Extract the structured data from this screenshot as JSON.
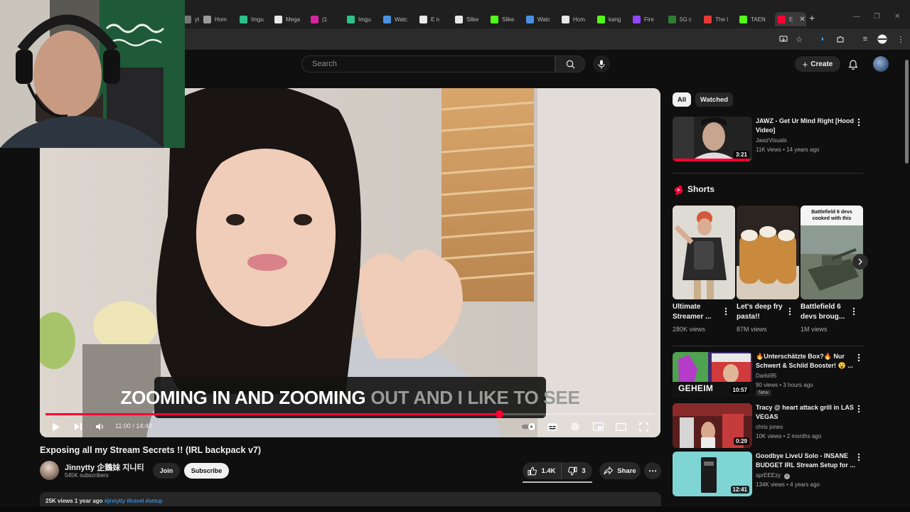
{
  "browser": {
    "tabs": [
      {
        "label": "yt",
        "color": "#777777"
      },
      {
        "label": "Hom",
        "color": "#9a9a9a"
      },
      {
        "label": "Imgu",
        "color": "#2ec28a"
      },
      {
        "label": "Mega",
        "color": "#e8e8e8"
      },
      {
        "label": "(1",
        "color": "#d6249f"
      },
      {
        "label": "Imgu",
        "color": "#2ec28a"
      },
      {
        "label": "Watc",
        "color": "#4a90e2"
      },
      {
        "label": "E n",
        "color": "#e8e8e8"
      },
      {
        "label": "Slike",
        "color": "#e8e8e8"
      },
      {
        "label": "Slike",
        "color": "#53fc18"
      },
      {
        "label": "Watc",
        "color": "#4a90e2"
      },
      {
        "label": "Hom",
        "color": "#e8e8e8"
      },
      {
        "label": "kang",
        "color": "#53fc18"
      },
      {
        "label": "Fire",
        "color": "#9146ff"
      },
      {
        "label": "5G c",
        "color": "#2e7d32"
      },
      {
        "label": "The I",
        "color": "#e53935"
      },
      {
        "label": "TAEN",
        "color": "#53fc18"
      },
      {
        "label": "E",
        "color": "#ff0033"
      }
    ]
  },
  "masthead": {
    "search_placeholder": "Search",
    "create_label": "Create"
  },
  "player": {
    "caption_main": "ZOOMING IN AND ZOOMING",
    "caption_rest": "OUT AND I LIKE TO SEE",
    "time": "11:00 / 14:48",
    "progress_fraction": 0.743
  },
  "video": {
    "title": "Exposing all my Stream Secrets !! (IRL backpack v7)",
    "channel": "Jinnytty 企鵝妹 지니티",
    "subscribers": "545K subscribers",
    "join_label": "Join",
    "subscribe_label": "Subscribe",
    "likes": "1.4K",
    "dislikes": "3",
    "share_label": "Share",
    "desc_stats": "25K views  1 year ago",
    "desc_tags": "#jinnytty  #travel  #setup"
  },
  "sidebar": {
    "chips": [
      "All",
      "Watched"
    ],
    "shorts_heading": "Shorts",
    "videos": [
      {
        "title": "JAWZ - Get Ur Mind Right [Hood Video]",
        "channel": "JawzVisuals",
        "meta": "11K views • 14 years ago",
        "duration": "3:21"
      },
      {
        "title": "🔥Unterschätzte Box?🔥 Nur Schwert & Schild Booster! 😮 ...",
        "channel": "Darkii95",
        "meta": "90 views • 3 hours ago",
        "duration": "10:57",
        "badge": "New"
      },
      {
        "title": "Tracy @ heart attack grill in LAS VEGAS",
        "channel": "chris jones",
        "meta": "10K views • 2 months ago",
        "duration": "0:29"
      },
      {
        "title": "Goodbye LiveU Solo - INSANE BUDGET IRL Stream Setup for ...",
        "channel": "sprEEEzy",
        "meta": "134K views • 4 years ago",
        "duration": "12:41"
      }
    ],
    "shorts": [
      {
        "title": "Ultimate Streamer ...",
        "views": "280K views"
      },
      {
        "title": "Let's deep fry pasta!!",
        "views": "87M views"
      },
      {
        "title": "Battlefield 6 devs broug...",
        "views": "1M views",
        "overlay": "Battlefield 6 devs cooked with this"
      }
    ]
  },
  "colors": {
    "accent": "#ff0033",
    "background": "#0f0f0f",
    "chip_bg": "#272727",
    "link": "#3ea6ff"
  }
}
